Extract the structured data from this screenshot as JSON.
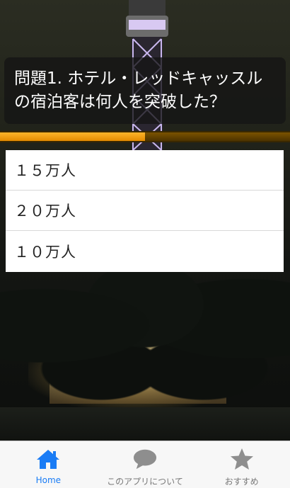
{
  "question": {
    "text": "問題1. ホテル・レッドキャッスルの宿泊客は何人を突破した？"
  },
  "progress": {
    "fraction": 0.5
  },
  "answers": [
    {
      "label": "１５万人"
    },
    {
      "label": "２０万人"
    },
    {
      "label": "１０万人"
    }
  ],
  "tabbar": {
    "tabs": [
      {
        "label": "Home",
        "icon": "home-icon",
        "active": true
      },
      {
        "label": "このアプリについて",
        "icon": "speech-bubble-icon",
        "active": false
      },
      {
        "label": "おすすめ",
        "icon": "star-icon",
        "active": false
      }
    ]
  },
  "colors": {
    "accent": "#1a7cf5",
    "inactive_icon": "#8e8e8e",
    "progress": "#f39c12"
  }
}
